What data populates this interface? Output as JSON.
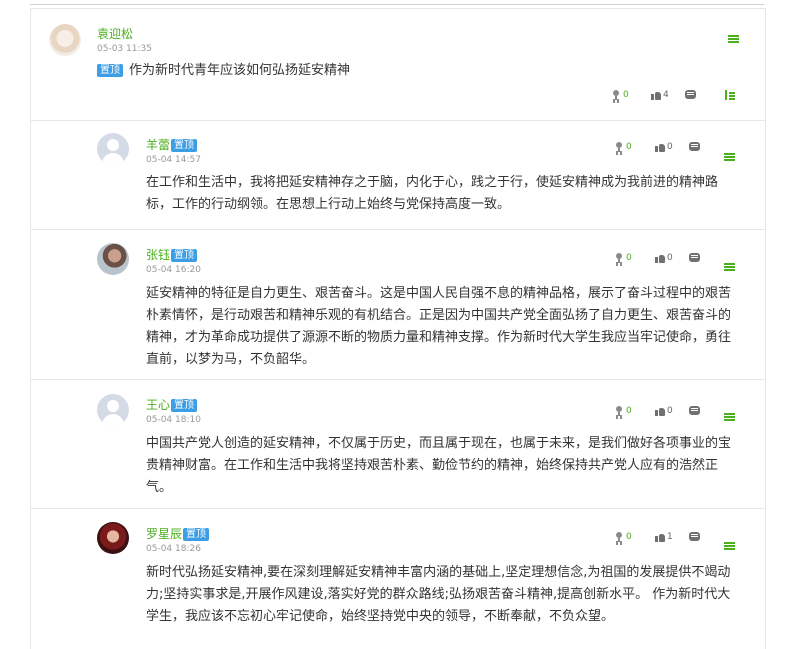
{
  "main_post": {
    "author": "袁迎松",
    "date": "05-03 11:35",
    "badge": "置顶",
    "title": "作为新时代青年应该如何弘扬延安精神",
    "awards": "0",
    "likes": "4"
  },
  "replies": [
    {
      "author": "羊蕾",
      "badge": "置顶",
      "date": "05-04 14:57",
      "awards": "0",
      "likes": "0",
      "content": "在工作和生活中，我将把延安精神存之于脑，内化于心，践之于行，使延安精神成为我前进的精神路标，工作的行动纲领。在思想上行动上始终与党保持高度一致。"
    },
    {
      "author": "张钰",
      "badge": "置顶",
      "date": "05-04 16:20",
      "awards": "0",
      "likes": "0",
      "content": "延安精神的特征是自力更生、艰苦奋斗。这是中国人民自强不息的精神品格，展示了奋斗过程中的艰苦朴素情怀，是行动艰苦和精神乐观的有机结合。正是因为中国共产党全面弘扬了自力更生、艰苦奋斗的精神，才为革命成功提供了源源不断的物质力量和精神支撑。作为新时代大学生我应当牢记使命，勇往直前，以梦为马，不负韶华。"
    },
    {
      "author": "王心",
      "badge": "置顶",
      "date": "05-04 18:10",
      "awards": "0",
      "likes": "0",
      "content": "中国共产党人创造的延安精神，不仅属于历史，而且属于现在，也属于未来，是我们做好各项事业的宝贵精神财富。在工作和生活中我将坚持艰苦朴素、勤俭节约的精神，始终保持共产党人应有的浩然正气。"
    },
    {
      "author": "罗星辰",
      "badge": "置顶",
      "date": "05-04 18:26",
      "awards": "0",
      "likes": "1",
      "content": "新时代弘扬延安精神,要在深刻理解延安精神丰富内涵的基础上,坚定理想信念,为祖国的发展提供不竭动力;坚持实事求是,开展作风建设,落实好党的群众路线;弘扬艰苦奋斗精神,提高创新水平。 作为新时代大学生，我应该不忘初心牢记使命，始终坚持党中央的领导，不断奉献，不负众望。"
    }
  ]
}
